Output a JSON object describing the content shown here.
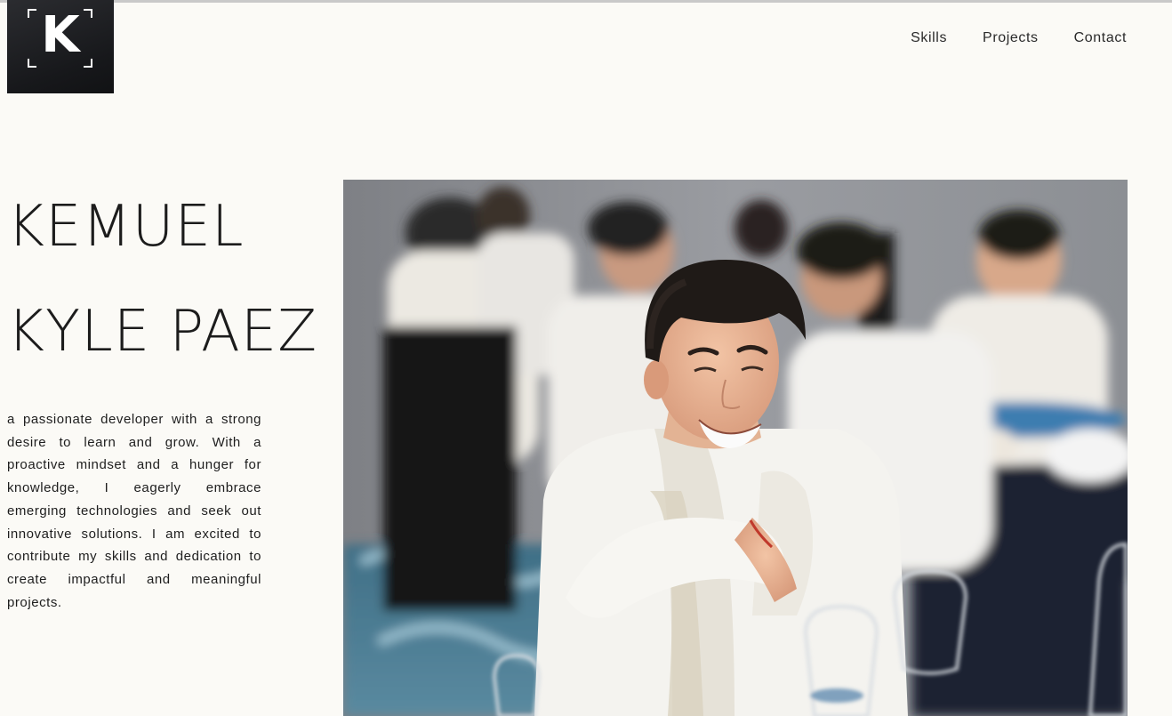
{
  "logo": {
    "letter": "K"
  },
  "nav": {
    "items": [
      {
        "label": "Skills"
      },
      {
        "label": "Projects"
      },
      {
        "label": "Contact"
      }
    ]
  },
  "hero": {
    "name_line1": "KEMUEL",
    "name_line2": "KYLE PAEZ",
    "bio": "a passionate developer with a strong desire to learn and grow. With a proactive mindset and a hunger for knowledge, I eagerly embrace emerging technologies and seek out innovative solutions. I am excited to contribute my skills and dedication to create impactful and meaningful projects."
  }
}
